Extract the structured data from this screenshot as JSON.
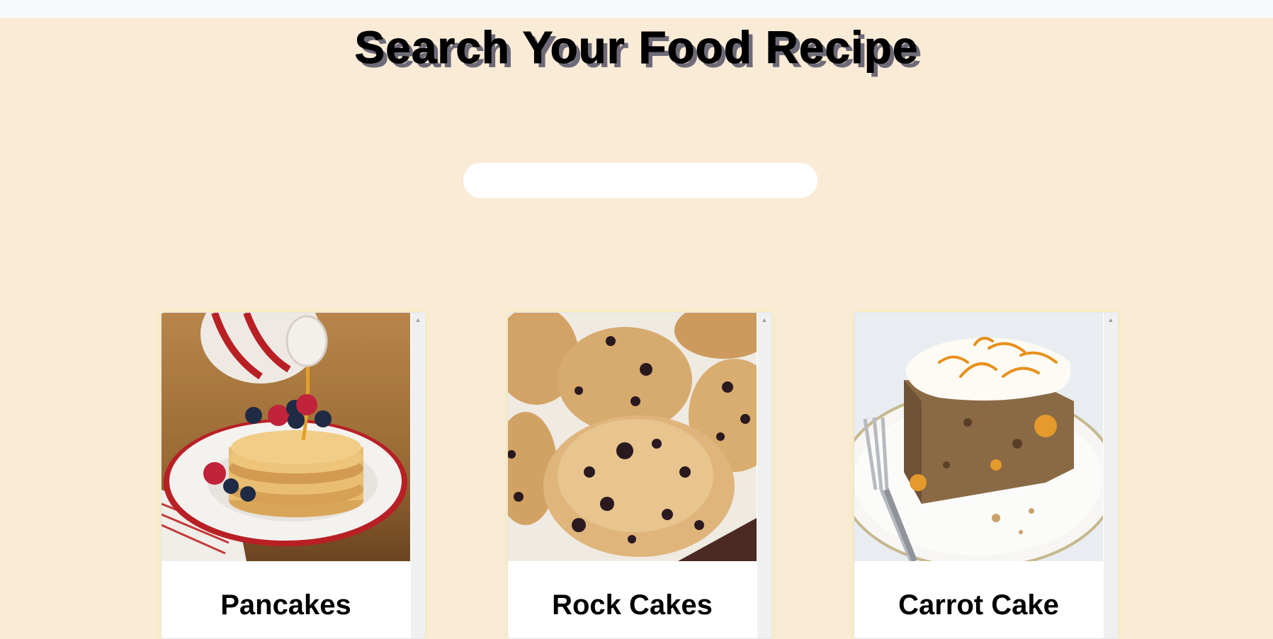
{
  "page": {
    "title": "Search Your Food Recipe"
  },
  "search": {
    "value": "",
    "placeholder": ""
  },
  "recipes": [
    {
      "name": "Pancakes",
      "image": "pancakes-photo"
    },
    {
      "name": "Rock Cakes",
      "image": "rock-cakes-photo"
    },
    {
      "name": "Carrot Cake",
      "image": "carrot-cake-photo"
    }
  ],
  "colors": {
    "background": "#faebd7",
    "card": "#ffffff",
    "title_shadow": "#6e6a78"
  }
}
